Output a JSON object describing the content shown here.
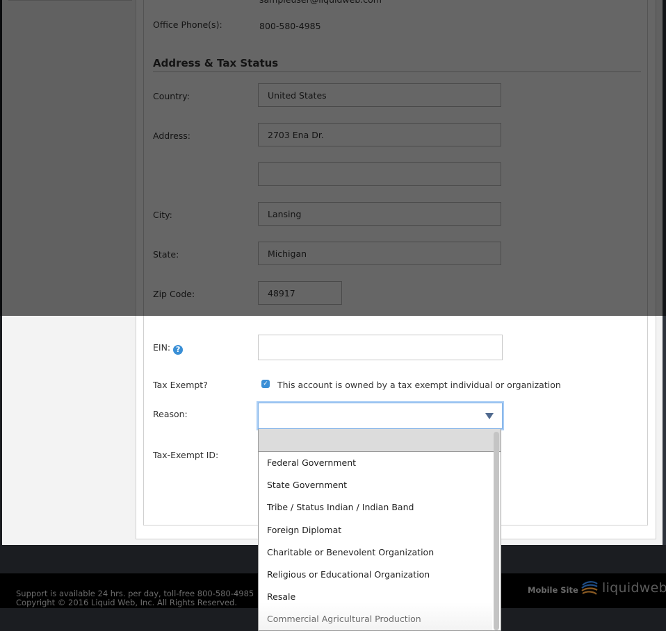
{
  "contact": {
    "email_partial": "sampleuser@liquidweb.com",
    "office_phone_label": "Office Phone(s):",
    "office_phone_value": "800-580-4985"
  },
  "section": {
    "title": "Address & Tax Status"
  },
  "form": {
    "country": {
      "label": "Country:",
      "value": "United States"
    },
    "address": {
      "label": "Address:",
      "value": "2703 Ena Dr.",
      "value2": ""
    },
    "city": {
      "label": "City:",
      "value": "Lansing"
    },
    "state": {
      "label": "State:",
      "value": "Michigan"
    },
    "zip": {
      "label": "Zip Code:",
      "value": "48917"
    },
    "ein": {
      "label": "EIN:",
      "value": "",
      "help_icon": "question-circle-icon"
    },
    "tax_exempt": {
      "label": "Tax Exempt?",
      "checked": true,
      "checkbox_label": "This account is owned by a tax exempt individual or organization"
    },
    "reason": {
      "label": "Reason:",
      "selected": "",
      "options": [
        "",
        "Federal Government",
        "State Government",
        "Tribe / Status Indian / Indian Band",
        "Foreign Diplomat",
        "Charitable or Benevolent Organization",
        "Religious or Educational Organization",
        "Resale",
        "Commercial Agricultural Production"
      ]
    },
    "tax_exempt_id": {
      "label": "Tax-Exempt ID:"
    }
  },
  "footer": {
    "support_text": "Support is available 24 hrs. per day, toll-free 800-580-4985",
    "copyright": "Copyright © 2016 Liquid Web, Inc. All Rights Reserved.",
    "mobile_site": "Mobile Site",
    "logo_text": "liquidweb"
  },
  "colors": {
    "accent": "#3a8fd6",
    "focus_ring": "#a9cdf5",
    "select_arrow": "#506a8f",
    "footer_bg": "#000000",
    "page_bg": "#1b1d21"
  }
}
